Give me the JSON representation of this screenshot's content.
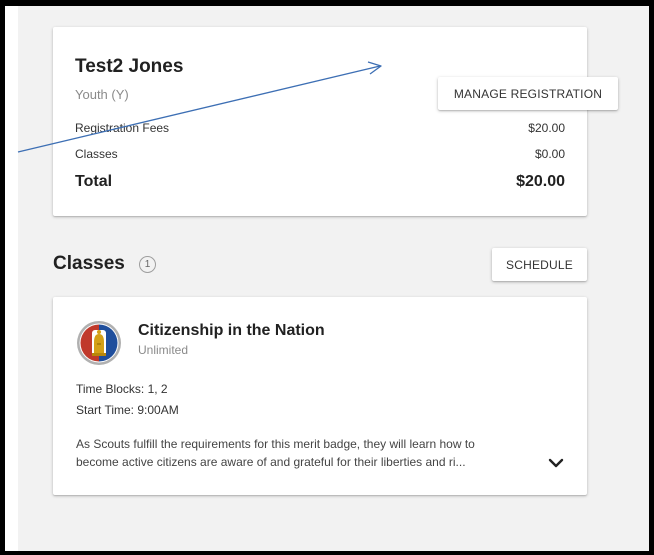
{
  "registration": {
    "name": "Test2 Jones",
    "type": "Youth (Y)",
    "manage_button": "MANAGE REGISTRATION",
    "fees": [
      {
        "label": "Registration Fees",
        "amount": "$20.00"
      },
      {
        "label": "Classes",
        "amount": "$0.00"
      }
    ],
    "total": {
      "label": "Total",
      "amount": "$20.00"
    }
  },
  "classes": {
    "title": "Classes",
    "count": "1",
    "schedule_button": "SCHEDULE",
    "items": [
      {
        "name": "Citizenship in the Nation",
        "capacity": "Unlimited",
        "time_blocks": "Time Blocks: 1, 2",
        "start_time": "Start Time: 9:00AM",
        "description_line1": "As Scouts fulfill the requirements for this merit badge, they will learn how to",
        "description_line2": "become active citizens are aware of and grateful for their liberties and ri..."
      }
    ]
  },
  "icons": {
    "merit_badge": "citizenship-merit-badge-icon",
    "expand": "chevron-down-icon"
  },
  "colors": {
    "annotation_arrow": "#3d6fb4",
    "badge_red": "#c0392b",
    "badge_blue": "#1f4e9c"
  }
}
